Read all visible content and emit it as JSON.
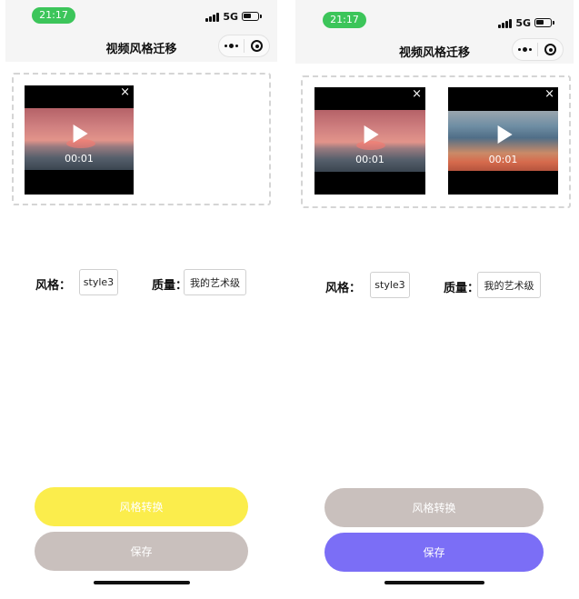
{
  "screens": [
    {
      "status_bar": {
        "time": "21:17",
        "network": "5G"
      },
      "nav": {
        "title": "视频风格迁移"
      },
      "videos": [
        {
          "duration": "00:01",
          "delete_icon": "×"
        }
      ],
      "form": {
        "style_label": "风格：",
        "style_value": "style3",
        "quality_label": "质量：",
        "quality_value": "我的艺术级"
      },
      "buttons": {
        "convert": "风格转换",
        "save": "保存"
      }
    },
    {
      "status_bar": {
        "time": "21:17",
        "network": "5G"
      },
      "nav": {
        "title": "视频风格迁移"
      },
      "videos": [
        {
          "duration": "00:01",
          "delete_icon": "×"
        },
        {
          "duration": "00:01",
          "delete_icon": "×"
        }
      ],
      "form": {
        "style_label": "风格：",
        "style_value": "style3",
        "quality_label": "质量：",
        "quality_value": "我的艺术级"
      },
      "buttons": {
        "convert": "风格转换",
        "save": "保存"
      }
    }
  ],
  "colors": {
    "time_pill": "#3cc55a",
    "convert_active": "#fbed4c",
    "button_disabled": "#c9c0bd",
    "save_active": "#7b6ef6"
  }
}
